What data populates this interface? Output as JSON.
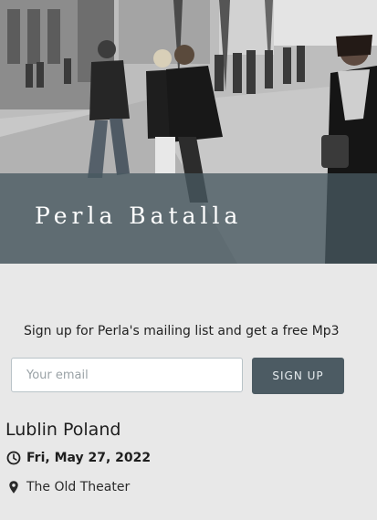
{
  "hero": {
    "title": "Perla Batalla",
    "image": "grayscale street crowd photo"
  },
  "mailing_list": {
    "heading": "Sign up for Perla's mailing list and get a free Mp3",
    "email_placeholder": "Your email",
    "email_value": "",
    "submit_label": "SIGN UP"
  },
  "event": {
    "city": "Lublin Poland",
    "date": "Fri, May 27, 2022",
    "venue": "The Old Theater",
    "date_icon": "clock-icon",
    "venue_icon": "map-pin-icon"
  },
  "colors": {
    "page_background": "#e8e8e8",
    "band": "#485860",
    "button": "#4c5b63",
    "button_text": "#e6ecef",
    "text": "#1e1e1e"
  }
}
